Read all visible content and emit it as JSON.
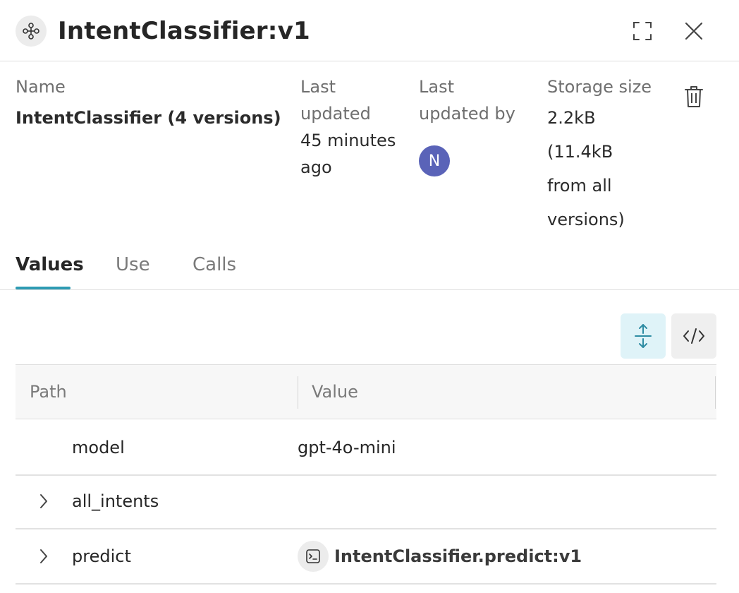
{
  "header": {
    "title": "IntentClassifier:v1",
    "icon": "object-nodes-icon"
  },
  "meta": {
    "name_label": "Name",
    "name_value": "IntentClassifier (4 versions)",
    "last_updated_label_1": "Last",
    "last_updated_label_2": "updated",
    "last_updated_value_1": "45 minutes",
    "last_updated_value_2": "ago",
    "last_updated_by_label_1": "Last",
    "last_updated_by_label_2": "updated by",
    "avatar_initial": "N",
    "storage_label": "Storage size",
    "storage_value_1": "2.2kB",
    "storage_value_2": "(11.4kB",
    "storage_value_3": "from all",
    "storage_value_4": "versions)"
  },
  "tabs": [
    {
      "label": "Values",
      "active": true
    },
    {
      "label": "Use",
      "active": false
    },
    {
      "label": "Calls",
      "active": false
    }
  ],
  "table": {
    "columns": [
      "Path",
      "Value"
    ],
    "rows": [
      {
        "path": "model",
        "value": "gpt-4o-mini",
        "expandable": false
      },
      {
        "path": "all_intents",
        "value": "",
        "expandable": true
      },
      {
        "path": "predict",
        "value": "IntentClassifier.predict:v1",
        "expandable": true,
        "value_icon": "terminal-icon"
      }
    ]
  },
  "colors": {
    "accent": "#2e9bb3",
    "avatar": "#5a63b8",
    "active_tool_bg": "#dff3f8"
  }
}
